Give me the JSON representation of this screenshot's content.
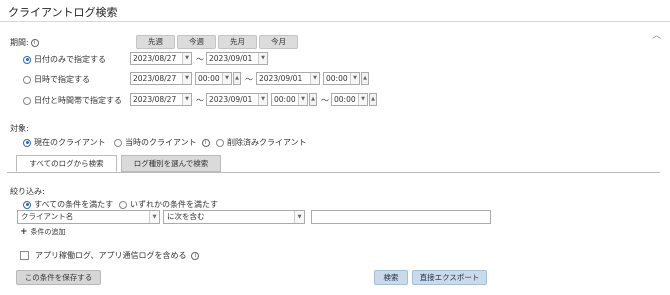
{
  "title": "クライアントログ検索",
  "period": {
    "label": "期間:",
    "quick_buttons": [
      "先週",
      "今週",
      "先月",
      "今月"
    ],
    "modes": [
      {
        "label": "日付のみで指定する",
        "selected": true,
        "from_date": "2023/08/27",
        "to_date": "2023/09/01"
      },
      {
        "label": "日時で指定する",
        "selected": false,
        "from_date": "2023/08/27",
        "from_time": "00:00",
        "to_date": "2023/09/01",
        "to_time": "00:00"
      },
      {
        "label": "日付と時間帯で指定する",
        "selected": false,
        "from_date": "2023/08/27",
        "to_date": "2023/09/01",
        "from_time": "00:00",
        "to_time": "00:00"
      }
    ],
    "tilde": "〜"
  },
  "target": {
    "label": "対象:",
    "options": [
      {
        "label": "現在のクライアント",
        "selected": true
      },
      {
        "label": "当時のクライアント",
        "selected": false
      },
      {
        "label": "削除済みクライアント",
        "selected": false
      }
    ]
  },
  "tabs": [
    {
      "label": "すべてのログから検索",
      "active": true
    },
    {
      "label": "ログ種別を選んで検索",
      "active": false
    }
  ],
  "filter": {
    "label": "絞り込み:",
    "match_options": [
      {
        "label": "すべての条件を満たす",
        "selected": true
      },
      {
        "label": "いずれかの条件を満たす",
        "selected": false
      }
    ],
    "field_select": "クライアント名",
    "operator_select": "に次を含む",
    "value": "",
    "add_condition": "条件の追加"
  },
  "include_app_logs": {
    "label": "アプリ稼働ログ、アプリ通信ログを含める",
    "checked": false
  },
  "buttons": {
    "save": "この条件を保存する",
    "search": "検索",
    "export": "直接エクスポート"
  }
}
